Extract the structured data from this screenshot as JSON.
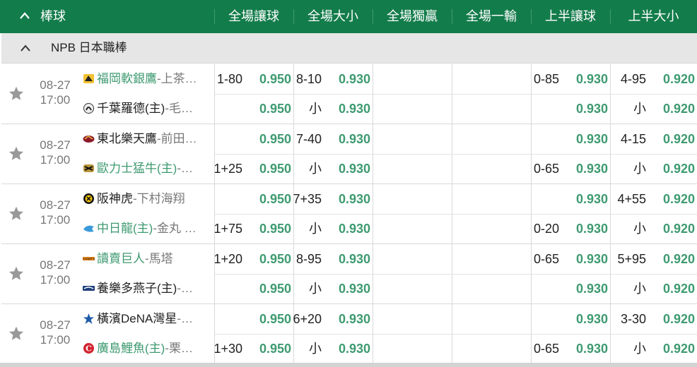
{
  "header": {
    "sport": "棒球",
    "columns": [
      "全場讓球",
      "全場大小",
      "全場獨贏",
      "全場一輸",
      "上半讓球",
      "上半大小"
    ]
  },
  "league": {
    "name": "NPB 日本職棒"
  },
  "matches": [
    {
      "date": "08-27",
      "time": "17:00",
      "teams": [
        {
          "name": "福岡軟銀鷹",
          "pitcher": "-上茶…",
          "highlight": true,
          "logo": "hawks"
        },
        {
          "name": "千葉羅德(主)",
          "pitcher": "-毛…",
          "highlight": false,
          "logo": "marines"
        }
      ],
      "markets": [
        [
          {
            "line": "1-80",
            "odds": "0.950"
          },
          {
            "line": "",
            "odds": "0.950"
          }
        ],
        [
          {
            "line": "8-10",
            "odds": "0.930"
          },
          {
            "line": "小",
            "odds": "0.930"
          }
        ],
        [
          {
            "line": "",
            "odds": ""
          },
          {
            "line": "",
            "odds": ""
          }
        ],
        [
          {
            "line": "",
            "odds": ""
          },
          {
            "line": "",
            "odds": ""
          }
        ],
        [
          {
            "line": "0-85",
            "odds": "0.930"
          },
          {
            "line": "",
            "odds": "0.930"
          }
        ],
        [
          {
            "line": "4-95",
            "odds": "0.920"
          },
          {
            "line": "小",
            "odds": "0.920"
          }
        ]
      ]
    },
    {
      "date": "08-27",
      "time": "17:00",
      "teams": [
        {
          "name": "東北樂天鷹",
          "pitcher": "-前田…",
          "highlight": false,
          "logo": "eagles"
        },
        {
          "name": "歐力士猛牛(主)",
          "pitcher": "-…",
          "highlight": true,
          "logo": "buffaloes"
        }
      ],
      "markets": [
        [
          {
            "line": "",
            "odds": "0.950"
          },
          {
            "line": "1+25",
            "odds": "0.950"
          }
        ],
        [
          {
            "line": "7-40",
            "odds": "0.930"
          },
          {
            "line": "小",
            "odds": "0.930"
          }
        ],
        [
          {
            "line": "",
            "odds": ""
          },
          {
            "line": "",
            "odds": ""
          }
        ],
        [
          {
            "line": "",
            "odds": ""
          },
          {
            "line": "",
            "odds": ""
          }
        ],
        [
          {
            "line": "",
            "odds": "0.930"
          },
          {
            "line": "0-65",
            "odds": "0.930"
          }
        ],
        [
          {
            "line": "4-15",
            "odds": "0.920"
          },
          {
            "line": "小",
            "odds": "0.920"
          }
        ]
      ]
    },
    {
      "date": "08-27",
      "time": "17:00",
      "teams": [
        {
          "name": "阪神虎",
          "pitcher": "-下村海翔",
          "highlight": false,
          "logo": "tigers"
        },
        {
          "name": "中日龍(主)",
          "pitcher": "-金丸 …",
          "highlight": true,
          "logo": "dragons"
        }
      ],
      "markets": [
        [
          {
            "line": "",
            "odds": "0.950"
          },
          {
            "line": "1+75",
            "odds": "0.950"
          }
        ],
        [
          {
            "line": "7+35",
            "odds": "0.930"
          },
          {
            "line": "小",
            "odds": "0.930"
          }
        ],
        [
          {
            "line": "",
            "odds": ""
          },
          {
            "line": "",
            "odds": ""
          }
        ],
        [
          {
            "line": "",
            "odds": ""
          },
          {
            "line": "",
            "odds": ""
          }
        ],
        [
          {
            "line": "",
            "odds": "0.930"
          },
          {
            "line": "0-20",
            "odds": "0.930"
          }
        ],
        [
          {
            "line": "4+55",
            "odds": "0.920"
          },
          {
            "line": "小",
            "odds": "0.920"
          }
        ]
      ]
    },
    {
      "date": "08-27",
      "time": "17:00",
      "teams": [
        {
          "name": "讀賣巨人",
          "pitcher": "-馬塔",
          "highlight": true,
          "logo": "giants"
        },
        {
          "name": "養樂多燕子(主)",
          "pitcher": "-…",
          "highlight": false,
          "logo": "swallows"
        }
      ],
      "markets": [
        [
          {
            "line": "1+20",
            "odds": "0.950"
          },
          {
            "line": "",
            "odds": "0.950"
          }
        ],
        [
          {
            "line": "8-95",
            "odds": "0.930"
          },
          {
            "line": "小",
            "odds": "0.930"
          }
        ],
        [
          {
            "line": "",
            "odds": ""
          },
          {
            "line": "",
            "odds": ""
          }
        ],
        [
          {
            "line": "",
            "odds": ""
          },
          {
            "line": "",
            "odds": ""
          }
        ],
        [
          {
            "line": "0-65",
            "odds": "0.930"
          },
          {
            "line": "",
            "odds": "0.930"
          }
        ],
        [
          {
            "line": "5+95",
            "odds": "0.920"
          },
          {
            "line": "小",
            "odds": "0.920"
          }
        ]
      ]
    },
    {
      "date": "08-27",
      "time": "17:00",
      "teams": [
        {
          "name": "橫濱DeNA灣星",
          "pitcher": "-…",
          "highlight": false,
          "logo": "baystars"
        },
        {
          "name": "廣島鯉魚(主)",
          "pitcher": "-栗…",
          "highlight": true,
          "logo": "carp"
        }
      ],
      "markets": [
        [
          {
            "line": "",
            "odds": "0.950"
          },
          {
            "line": "1+30",
            "odds": "0.950"
          }
        ],
        [
          {
            "line": "6+20",
            "odds": "0.930"
          },
          {
            "line": "小",
            "odds": "0.930"
          }
        ],
        [
          {
            "line": "",
            "odds": ""
          },
          {
            "line": "",
            "odds": ""
          }
        ],
        [
          {
            "line": "",
            "odds": ""
          },
          {
            "line": "",
            "odds": ""
          }
        ],
        [
          {
            "line": "",
            "odds": "0.930"
          },
          {
            "line": "0-65",
            "odds": "0.930"
          }
        ],
        [
          {
            "line": "3-30",
            "odds": "0.920"
          },
          {
            "line": "小",
            "odds": "0.920"
          }
        ]
      ]
    }
  ],
  "colors": {
    "header_bg": "#137c4b",
    "odds_green": "#3e9a70",
    "league_bg": "#e6e6e6"
  }
}
